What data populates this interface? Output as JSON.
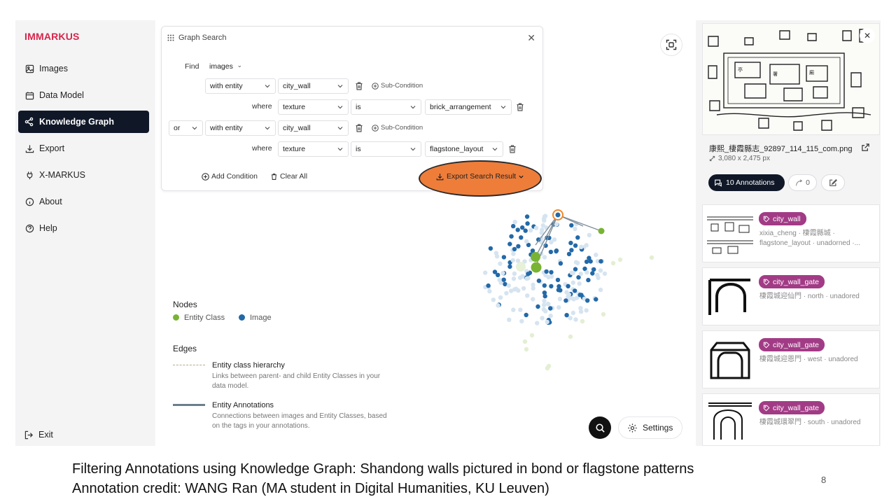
{
  "app": {
    "brand": "IMMARKUS"
  },
  "sidebar": {
    "items": [
      {
        "label": "Images",
        "icon": "image-icon"
      },
      {
        "label": "Data Model",
        "icon": "folder-icon"
      },
      {
        "label": "Knowledge Graph",
        "icon": "graph-icon",
        "active": true
      },
      {
        "label": "Export",
        "icon": "download-icon"
      },
      {
        "label": "X-MARKUS",
        "icon": "plug-icon"
      },
      {
        "label": "About",
        "icon": "info-icon"
      },
      {
        "label": "Help",
        "icon": "help-icon"
      }
    ],
    "exit_label": "Exit"
  },
  "search": {
    "title": "Graph Search",
    "find_label": "Find",
    "find_value": "images",
    "where_label": "where",
    "or_value": "or",
    "cond1": {
      "relation": "with entity",
      "entity": "city_wall",
      "property": "texture",
      "operator": "is",
      "value": "brick_arrangement"
    },
    "cond2": {
      "relation": "with entity",
      "entity": "city_wall",
      "property": "texture",
      "operator": "is",
      "value": "flagstone_layout"
    },
    "sub_condition_label": "Sub-Condition",
    "add_condition_label": "Add Condition",
    "clear_all_label": "Clear All",
    "export_label": "Export Search Result"
  },
  "legend": {
    "nodes_heading": "Nodes",
    "entity_class_label": "Entity Class",
    "image_label": "Image",
    "edges_heading": "Edges",
    "hierarchy_title": "Entity class hierarchy",
    "hierarchy_desc": "Links between parent- and child Entity Classes in your data model.",
    "annotations_title": "Entity Annotations",
    "annotations_desc": "Connections between images and Entity Classes, based on the tags in your annotations.",
    "colors": {
      "entity_class": "#78b334",
      "image": "#2369a8"
    }
  },
  "graph_controls": {
    "settings_label": "Settings"
  },
  "detail": {
    "filename": "康熙_棲霞縣志_92897_114_115_com.png",
    "dimensions": "3,080 x 2,475 px",
    "annotations_label": "10 Annotations",
    "relations_count": "0",
    "annotations": [
      {
        "tag": "city_wall",
        "text": "xixia_cheng · 棲霞縣城 · flagstone_layout · unadorned ·..."
      },
      {
        "tag": "city_wall_gate",
        "text": "棲霞城迎仙門 · north · unadored"
      },
      {
        "tag": "city_wall_gate",
        "text": "棲霞城迎恩門 · west · unadored"
      },
      {
        "tag": "city_wall_gate",
        "text": "棲霞城環翠門 · south · unadored"
      }
    ]
  },
  "caption": {
    "line1": "Filtering Annotations using Knowledge Graph: Shandong walls pictured in bond or flagstone patterns",
    "line2": "Annotation credit: WANG Ran (MA student in Digital Humanities, KU Leuven)",
    "page_number": "8"
  }
}
